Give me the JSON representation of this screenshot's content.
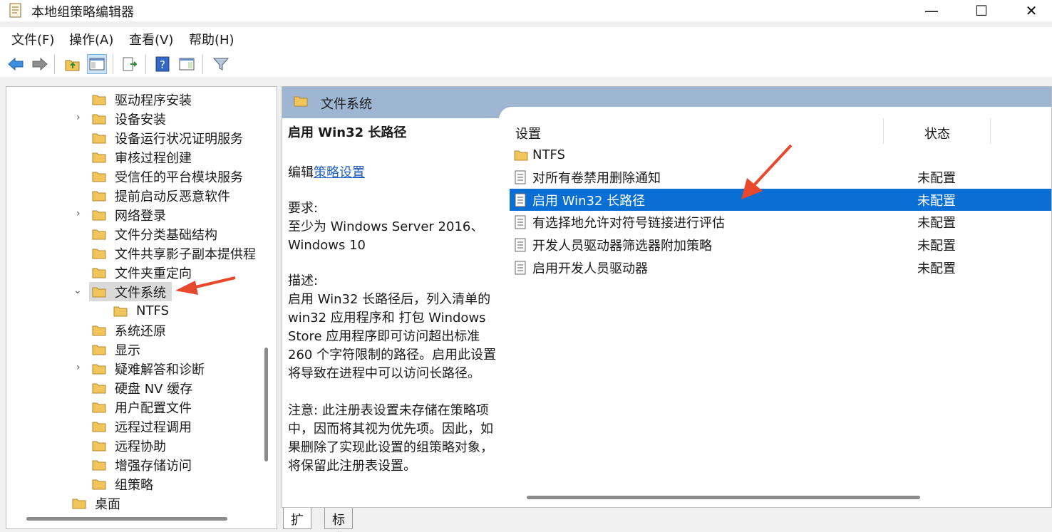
{
  "window": {
    "title": "本地组策略编辑器",
    "controls": [
      "—",
      "☐",
      "✕"
    ]
  },
  "menu": [
    "文件(F)",
    "操作(A)",
    "查看(V)",
    "帮助(H)"
  ],
  "toolbar": {
    "icons": [
      "back-arrow-icon",
      "forward-arrow-icon",
      "up-folder-icon",
      "show-hide-tree-icon",
      "export-list-icon",
      "help-icon",
      "extended-view-icon",
      "filter-icon"
    ]
  },
  "tree": {
    "items": [
      {
        "label": "驱动程序安装",
        "expandable": false
      },
      {
        "label": "设备安装",
        "expandable": true
      },
      {
        "label": "设备运行状况证明服务",
        "expandable": false
      },
      {
        "label": "审核过程创建",
        "expandable": false
      },
      {
        "label": "受信任的平台模块服务",
        "expandable": false
      },
      {
        "label": "提前启动反恶意软件",
        "expandable": false
      },
      {
        "label": "网络登录",
        "expandable": true
      },
      {
        "label": "文件分类基础结构",
        "expandable": false
      },
      {
        "label": "文件共享影子副本提供程",
        "expandable": false
      },
      {
        "label": "文件夹重定向",
        "expandable": false
      },
      {
        "label": "文件系统",
        "expandable": true,
        "expanded": true,
        "selected": true
      },
      {
        "label": "NTFS",
        "expandable": false,
        "child": true
      },
      {
        "label": "系统还原",
        "expandable": false
      },
      {
        "label": "显示",
        "expandable": false
      },
      {
        "label": "疑难解答和诊断",
        "expandable": true
      },
      {
        "label": "硬盘 NV 缓存",
        "expandable": false
      },
      {
        "label": "用户配置文件",
        "expandable": false
      },
      {
        "label": "远程过程调用",
        "expandable": false
      },
      {
        "label": "远程协助",
        "expandable": false
      },
      {
        "label": "增强存储访问",
        "expandable": false
      },
      {
        "label": "组策略",
        "expandable": false
      },
      {
        "label": "桌面",
        "expandable": false,
        "parent_level": true
      }
    ]
  },
  "details": {
    "header": "文件系统",
    "setting_title": "启用 Win32 长路径",
    "edit_prefix": "编辑",
    "edit_link": "策略设置",
    "requirement_label": "要求:",
    "requirement_line1": "至少为 Windows Server 2016、",
    "requirement_line2": "Windows 10",
    "description_label": "描述:",
    "description_lines": [
      "启用 Win32 长路径后，列入清单的",
      "win32 应用程序和 打包 Windows",
      "Store 应用程序即可访问超出标准",
      "260 个字符限制的路径。启用此设置",
      "将导致在进程中可以访问长路径。"
    ],
    "note_lines": [
      "注意: 此注册表设置未存储在策略项",
      "中，因而将其视为优先项。因此，如",
      "果删除了实现此设置的组策略对象，",
      "将保留此注册表设置。"
    ]
  },
  "list": {
    "col_setting": "设置",
    "col_state": "状态",
    "rows": [
      {
        "name": "NTFS",
        "state": "",
        "icon": "folder-icon"
      },
      {
        "name": "对所有卷禁用删除通知",
        "state": "未配置",
        "icon": "policy-setting-icon"
      },
      {
        "name": "启用 Win32 长路径",
        "state": "未配置",
        "icon": "policy-setting-icon",
        "selected": true
      },
      {
        "name": "有选择地允许对符号链接进行评估",
        "state": "未配置",
        "icon": "policy-setting-icon"
      },
      {
        "name": "开发人员驱动器筛选器附加策略",
        "state": "未配置",
        "icon": "policy-setting-icon"
      },
      {
        "name": "启用开发人员驱动器",
        "state": "未配置",
        "icon": "policy-setting-icon"
      }
    ]
  },
  "tabs": [
    "扩展",
    "标准"
  ],
  "colors": {
    "selection": "#0a6fd4",
    "header_band": "#9fb6d3",
    "annotation_arrow": "#e8482c",
    "folder": "#f2c55c"
  }
}
